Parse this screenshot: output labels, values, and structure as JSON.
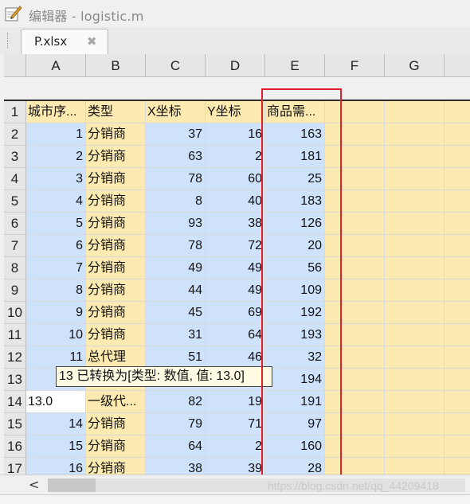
{
  "window": {
    "title": "编辑器 - logistic.m"
  },
  "tabs": [
    {
      "label": "P.xlsx",
      "close_glyph": "✖"
    }
  ],
  "columns": [
    "A",
    "B",
    "C",
    "D",
    "E",
    "F",
    "G"
  ],
  "header_row": {
    "row": "1",
    "cells": [
      "城市序...",
      "类型",
      "X坐标",
      "Y坐标",
      "商品需..."
    ]
  },
  "rows": [
    {
      "row": "2",
      "cells": [
        "1",
        "分销商",
        "37",
        "16",
        "163"
      ]
    },
    {
      "row": "3",
      "cells": [
        "2",
        "分销商",
        "63",
        "2",
        "181"
      ]
    },
    {
      "row": "4",
      "cells": [
        "3",
        "分销商",
        "78",
        "60",
        "25"
      ]
    },
    {
      "row": "5",
      "cells": [
        "4",
        "分销商",
        "8",
        "40",
        "183"
      ]
    },
    {
      "row": "6",
      "cells": [
        "5",
        "分销商",
        "93",
        "38",
        "126"
      ]
    },
    {
      "row": "7",
      "cells": [
        "6",
        "分销商",
        "78",
        "72",
        "20"
      ]
    },
    {
      "row": "8",
      "cells": [
        "7",
        "分销商",
        "49",
        "49",
        "56"
      ]
    },
    {
      "row": "9",
      "cells": [
        "8",
        "分销商",
        "44",
        "49",
        "109"
      ]
    },
    {
      "row": "10",
      "cells": [
        "9",
        "分销商",
        "45",
        "69",
        "192"
      ]
    },
    {
      "row": "11",
      "cells": [
        "10",
        "分销商",
        "31",
        "64",
        "193"
      ]
    },
    {
      "row": "12",
      "cells": [
        "11",
        "总代理",
        "51",
        "46",
        "32"
      ]
    },
    {
      "row": "13",
      "cells": [
        "",
        "",
        "",
        "",
        "194"
      ]
    },
    {
      "row": "14",
      "cells": [
        "13.0",
        "一级代...",
        "82",
        "19",
        "191"
      ]
    },
    {
      "row": "15",
      "cells": [
        "14",
        "分销商",
        "79",
        "71",
        "97"
      ]
    },
    {
      "row": "16",
      "cells": [
        "15",
        "分销商",
        "64",
        "2",
        "160"
      ]
    },
    {
      "row": "17",
      "cells": [
        "16",
        "分销商",
        "38",
        "39",
        "28"
      ]
    }
  ],
  "tooltip": {
    "text": "13 已转换为[类型: 数值, 值: 13.0]"
  },
  "scrollbar": {
    "left_arrow": "<"
  },
  "watermark": "https://blog.csdn.net/qq_44209418",
  "colors": {
    "selection_blue": "#cfe2fb",
    "cell_yellow": "#fdeab0",
    "highlight_red": "#e0202b"
  }
}
